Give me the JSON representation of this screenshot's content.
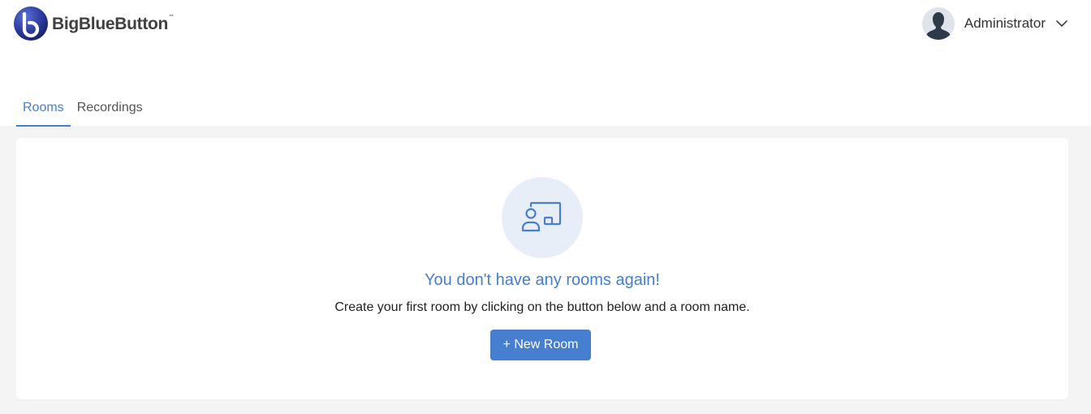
{
  "header": {
    "logo_text": "BigBlueButton",
    "logo_tm": "™",
    "user": {
      "name": "Administrator",
      "avatar_icon": "user-avatar-icon",
      "menu_icon": "chevron-down-icon"
    }
  },
  "tabs": [
    {
      "label": "Rooms",
      "active": true
    },
    {
      "label": "Recordings",
      "active": false
    }
  ],
  "empty_state": {
    "icon": "room-presentation-icon",
    "title": "You don't have any rooms again!",
    "text": "Create your first room by clicking on the button below and a room name.",
    "button_label": "+ New Room"
  },
  "colors": {
    "accent": "#467fcf",
    "background": "#f4f4f4",
    "icon_circle": "#e8eef8"
  }
}
